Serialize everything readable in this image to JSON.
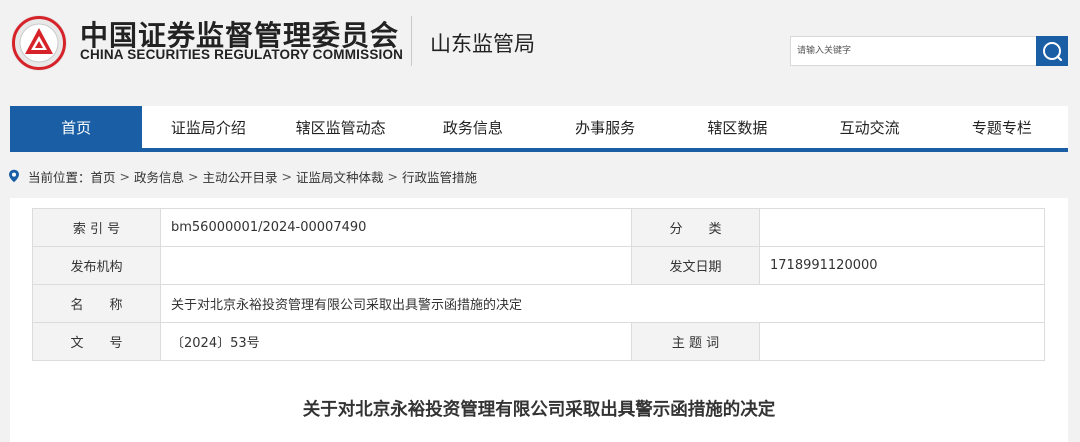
{
  "header": {
    "org_name_cn": "中国证券监督管理委员会",
    "org_name_en": "CHINA SECURITIES REGULATORY COMMISSION",
    "bureau": "山东监管局",
    "search_placeholder": "请输入关键字",
    "accent_color": "#1a5fa6",
    "logo_color": "#d6232a"
  },
  "nav": {
    "items": [
      {
        "label": "首页",
        "active": true
      },
      {
        "label": "证监局介绍"
      },
      {
        "label": "辖区监管动态"
      },
      {
        "label": "政务信息"
      },
      {
        "label": "办事服务"
      },
      {
        "label": "辖区数据"
      },
      {
        "label": "互动交流"
      },
      {
        "label": "专题专栏"
      }
    ]
  },
  "breadcrumb": {
    "prefix": "当前位置：",
    "items": [
      "首页",
      "政务信息",
      "主动公开目录",
      "证监局文种体裁",
      "行政监管措施"
    ],
    "separator": ">"
  },
  "info": {
    "index_label": "索 引 号",
    "index_value": "bm56000001/2024-00007490",
    "category_label": "分　　类",
    "category_value": "",
    "publisher_label": "发布机构",
    "publisher_value": "",
    "date_label": "发文日期",
    "date_value": "1718991120000",
    "name_label": "名　　称",
    "name_value": "关于对北京永裕投资管理有限公司采取出具警示函措施的决定",
    "docno_label": "文　　号",
    "docno_value": "〔2024〕53号",
    "keywords_label": "主 题 词",
    "keywords_value": ""
  },
  "document": {
    "title": "关于对北京永裕投资管理有限公司采取出具警示函措施的决定"
  }
}
